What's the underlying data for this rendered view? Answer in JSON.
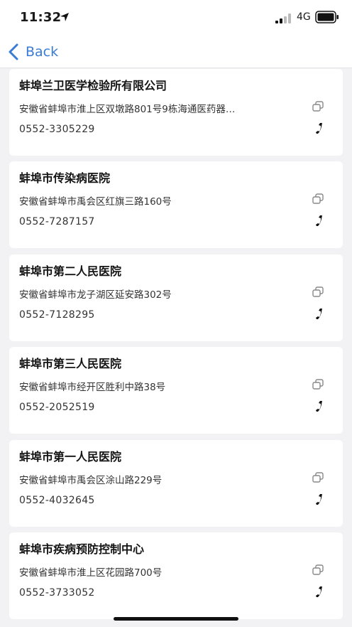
{
  "status_bar": {
    "time": "11:32",
    "network": "4G"
  },
  "nav": {
    "back_label": "Back"
  },
  "hospitals": [
    {
      "name": "蚌埠兰卫医学检验所有限公司",
      "address": "安徽省蚌埠市淮上区双墩路801号9栋海通医药器…",
      "phone": "0552-3305229"
    },
    {
      "name": "蚌埠市传染病医院",
      "address": "安徽省蚌埠市禹会区红旗三路160号",
      "phone": "0552-7287157"
    },
    {
      "name": "蚌埠市第二人民医院",
      "address": "安徽省蚌埠市龙子湖区延安路302号",
      "phone": "0552-7128295"
    },
    {
      "name": "蚌埠市第三人民医院",
      "address": "安徽省蚌埠市经开区胜利中路38号",
      "phone": "0552-2052519"
    },
    {
      "name": "蚌埠市第一人民医院",
      "address": "安徽省蚌埠市禹会区涂山路229号",
      "phone": "0552-4032645"
    },
    {
      "name": "蚌埠市疾病预防控制中心",
      "address": "安徽省蚌埠市淮上区花园路700号",
      "phone": "0552-3733052"
    }
  ]
}
